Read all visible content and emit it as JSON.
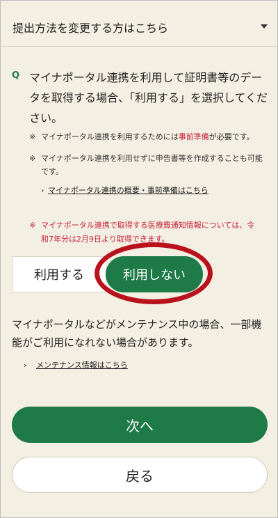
{
  "dropdown": {
    "label": "提出方法を変更する方はこちら",
    "icon": "caret-down-icon"
  },
  "question": {
    "mark": "Q",
    "text": "マイナポータル連携を利用して証明書等のデータを取得する場合、「利用する」を選択してください。"
  },
  "notes": [
    {
      "mark": "※",
      "before": "マイナポータル連携を利用するためには",
      "highlight": "事前準備",
      "after": "が必要です。"
    },
    {
      "mark": "※",
      "text": "マイナポータル連携を利用せずに申告書等を作成することも可能です。"
    }
  ],
  "overview_link": {
    "chevron": "›",
    "label": "マイナポータル連携の概要・事前準備はこちら"
  },
  "warning": {
    "mark": "※",
    "text": "マイナポータル連携で取得する医療費通知情報については、令和7年分は2月9日より取得できます。"
  },
  "choice": {
    "use_label": "利用する",
    "no_use_label": "利用しない",
    "selected": "利用しない"
  },
  "maintenance": {
    "text": "マイナポータルなどがメンテナンス中の場合、一部機能がご利用になれない場合があります。",
    "link_chevron": "›",
    "link_label": "メンテナンス情報はこちら"
  },
  "buttons": {
    "next": "次へ",
    "back": "戻る"
  },
  "colors": {
    "accent": "#1e7a47",
    "warning": "#c9223d",
    "highlight_ring": "#b8121d",
    "background": "#f3efe3"
  }
}
